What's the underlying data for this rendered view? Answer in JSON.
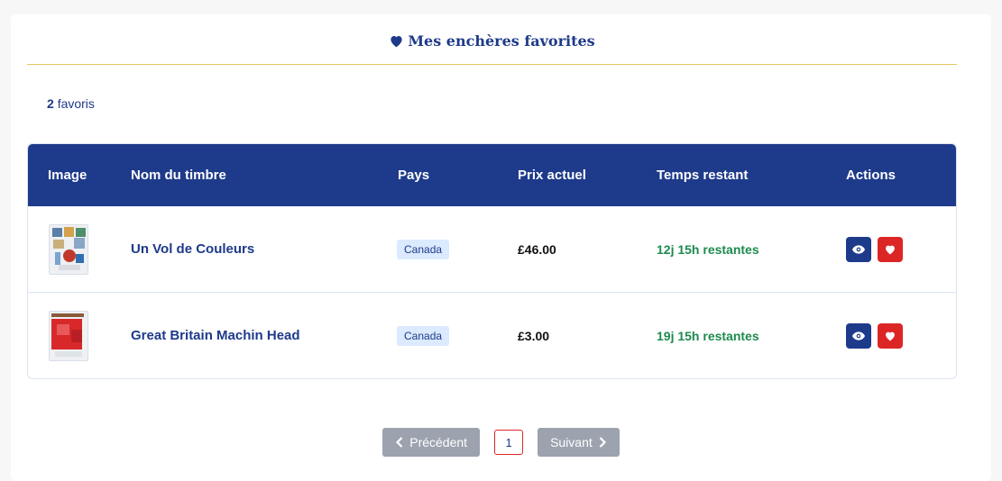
{
  "header": {
    "title": "Mes enchères favorites",
    "icon": "heart-icon"
  },
  "summary": {
    "count": "2",
    "count_label": "favoris"
  },
  "table": {
    "columns": [
      "Image",
      "Nom du timbre",
      "Pays",
      "Prix actuel",
      "Temps restant",
      "Actions"
    ],
    "rows": [
      {
        "name": "Un Vol de Couleurs",
        "country": "Canada",
        "price": "£46.00",
        "time_left": "12j 15h restantes",
        "thumbnail": "stamp-thumbnail"
      },
      {
        "name": "Great Britain Machin Head",
        "country": "Canada",
        "price": "£3.00",
        "time_left": "19j 15h restantes",
        "thumbnail": "stamp-thumbnail"
      }
    ],
    "actions": {
      "view_icon": "eye-icon",
      "remove_icon": "broken-heart-icon"
    }
  },
  "pagination": {
    "prev_label": "Précédent",
    "next_label": "Suivant",
    "current_page": "1"
  },
  "colors": {
    "primary": "#1e3a8a",
    "accent_rule": "#e3c55a",
    "danger": "#dc2626",
    "success": "#1d8a4e",
    "badge_bg": "#dbeafe",
    "disabled": "#9ca3af"
  }
}
